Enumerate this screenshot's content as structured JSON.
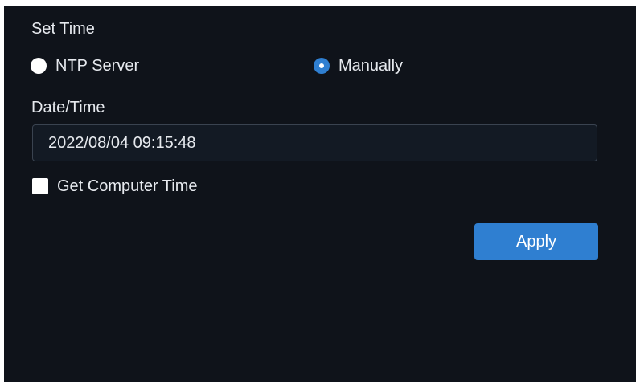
{
  "set_time": {
    "title": "Set Time",
    "options": [
      {
        "label": "NTP Server",
        "selected": false
      },
      {
        "label": "Manually",
        "selected": true
      }
    ]
  },
  "date_time": {
    "label": "Date/Time",
    "value": "2022/08/04 09:15:48"
  },
  "get_computer_time": {
    "label": "Get Computer Time",
    "checked": false
  },
  "apply_button": {
    "label": "Apply"
  },
  "colors": {
    "background": "#0f131a",
    "accent": "#2f7fd1",
    "text": "#e6e9ee",
    "input_border": "#3a4350"
  }
}
